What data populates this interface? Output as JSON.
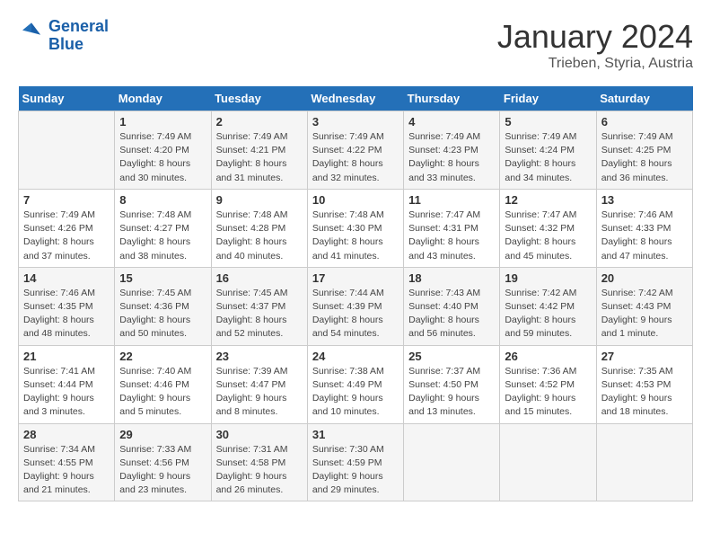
{
  "header": {
    "logo_line1": "General",
    "logo_line2": "Blue",
    "month": "January 2024",
    "location": "Trieben, Styria, Austria"
  },
  "weekdays": [
    "Sunday",
    "Monday",
    "Tuesday",
    "Wednesday",
    "Thursday",
    "Friday",
    "Saturday"
  ],
  "weeks": [
    [
      {
        "day": "",
        "info": ""
      },
      {
        "day": "1",
        "info": "Sunrise: 7:49 AM\nSunset: 4:20 PM\nDaylight: 8 hours\nand 30 minutes."
      },
      {
        "day": "2",
        "info": "Sunrise: 7:49 AM\nSunset: 4:21 PM\nDaylight: 8 hours\nand 31 minutes."
      },
      {
        "day": "3",
        "info": "Sunrise: 7:49 AM\nSunset: 4:22 PM\nDaylight: 8 hours\nand 32 minutes."
      },
      {
        "day": "4",
        "info": "Sunrise: 7:49 AM\nSunset: 4:23 PM\nDaylight: 8 hours\nand 33 minutes."
      },
      {
        "day": "5",
        "info": "Sunrise: 7:49 AM\nSunset: 4:24 PM\nDaylight: 8 hours\nand 34 minutes."
      },
      {
        "day": "6",
        "info": "Sunrise: 7:49 AM\nSunset: 4:25 PM\nDaylight: 8 hours\nand 36 minutes."
      }
    ],
    [
      {
        "day": "7",
        "info": "Sunrise: 7:49 AM\nSunset: 4:26 PM\nDaylight: 8 hours\nand 37 minutes."
      },
      {
        "day": "8",
        "info": "Sunrise: 7:48 AM\nSunset: 4:27 PM\nDaylight: 8 hours\nand 38 minutes."
      },
      {
        "day": "9",
        "info": "Sunrise: 7:48 AM\nSunset: 4:28 PM\nDaylight: 8 hours\nand 40 minutes."
      },
      {
        "day": "10",
        "info": "Sunrise: 7:48 AM\nSunset: 4:30 PM\nDaylight: 8 hours\nand 41 minutes."
      },
      {
        "day": "11",
        "info": "Sunrise: 7:47 AM\nSunset: 4:31 PM\nDaylight: 8 hours\nand 43 minutes."
      },
      {
        "day": "12",
        "info": "Sunrise: 7:47 AM\nSunset: 4:32 PM\nDaylight: 8 hours\nand 45 minutes."
      },
      {
        "day": "13",
        "info": "Sunrise: 7:46 AM\nSunset: 4:33 PM\nDaylight: 8 hours\nand 47 minutes."
      }
    ],
    [
      {
        "day": "14",
        "info": "Sunrise: 7:46 AM\nSunset: 4:35 PM\nDaylight: 8 hours\nand 48 minutes."
      },
      {
        "day": "15",
        "info": "Sunrise: 7:45 AM\nSunset: 4:36 PM\nDaylight: 8 hours\nand 50 minutes."
      },
      {
        "day": "16",
        "info": "Sunrise: 7:45 AM\nSunset: 4:37 PM\nDaylight: 8 hours\nand 52 minutes."
      },
      {
        "day": "17",
        "info": "Sunrise: 7:44 AM\nSunset: 4:39 PM\nDaylight: 8 hours\nand 54 minutes."
      },
      {
        "day": "18",
        "info": "Sunrise: 7:43 AM\nSunset: 4:40 PM\nDaylight: 8 hours\nand 56 minutes."
      },
      {
        "day": "19",
        "info": "Sunrise: 7:42 AM\nSunset: 4:42 PM\nDaylight: 8 hours\nand 59 minutes."
      },
      {
        "day": "20",
        "info": "Sunrise: 7:42 AM\nSunset: 4:43 PM\nDaylight: 9 hours\nand 1 minute."
      }
    ],
    [
      {
        "day": "21",
        "info": "Sunrise: 7:41 AM\nSunset: 4:44 PM\nDaylight: 9 hours\nand 3 minutes."
      },
      {
        "day": "22",
        "info": "Sunrise: 7:40 AM\nSunset: 4:46 PM\nDaylight: 9 hours\nand 5 minutes."
      },
      {
        "day": "23",
        "info": "Sunrise: 7:39 AM\nSunset: 4:47 PM\nDaylight: 9 hours\nand 8 minutes."
      },
      {
        "day": "24",
        "info": "Sunrise: 7:38 AM\nSunset: 4:49 PM\nDaylight: 9 hours\nand 10 minutes."
      },
      {
        "day": "25",
        "info": "Sunrise: 7:37 AM\nSunset: 4:50 PM\nDaylight: 9 hours\nand 13 minutes."
      },
      {
        "day": "26",
        "info": "Sunrise: 7:36 AM\nSunset: 4:52 PM\nDaylight: 9 hours\nand 15 minutes."
      },
      {
        "day": "27",
        "info": "Sunrise: 7:35 AM\nSunset: 4:53 PM\nDaylight: 9 hours\nand 18 minutes."
      }
    ],
    [
      {
        "day": "28",
        "info": "Sunrise: 7:34 AM\nSunset: 4:55 PM\nDaylight: 9 hours\nand 21 minutes."
      },
      {
        "day": "29",
        "info": "Sunrise: 7:33 AM\nSunset: 4:56 PM\nDaylight: 9 hours\nand 23 minutes."
      },
      {
        "day": "30",
        "info": "Sunrise: 7:31 AM\nSunset: 4:58 PM\nDaylight: 9 hours\nand 26 minutes."
      },
      {
        "day": "31",
        "info": "Sunrise: 7:30 AM\nSunset: 4:59 PM\nDaylight: 9 hours\nand 29 minutes."
      },
      {
        "day": "",
        "info": ""
      },
      {
        "day": "",
        "info": ""
      },
      {
        "day": "",
        "info": ""
      }
    ]
  ]
}
